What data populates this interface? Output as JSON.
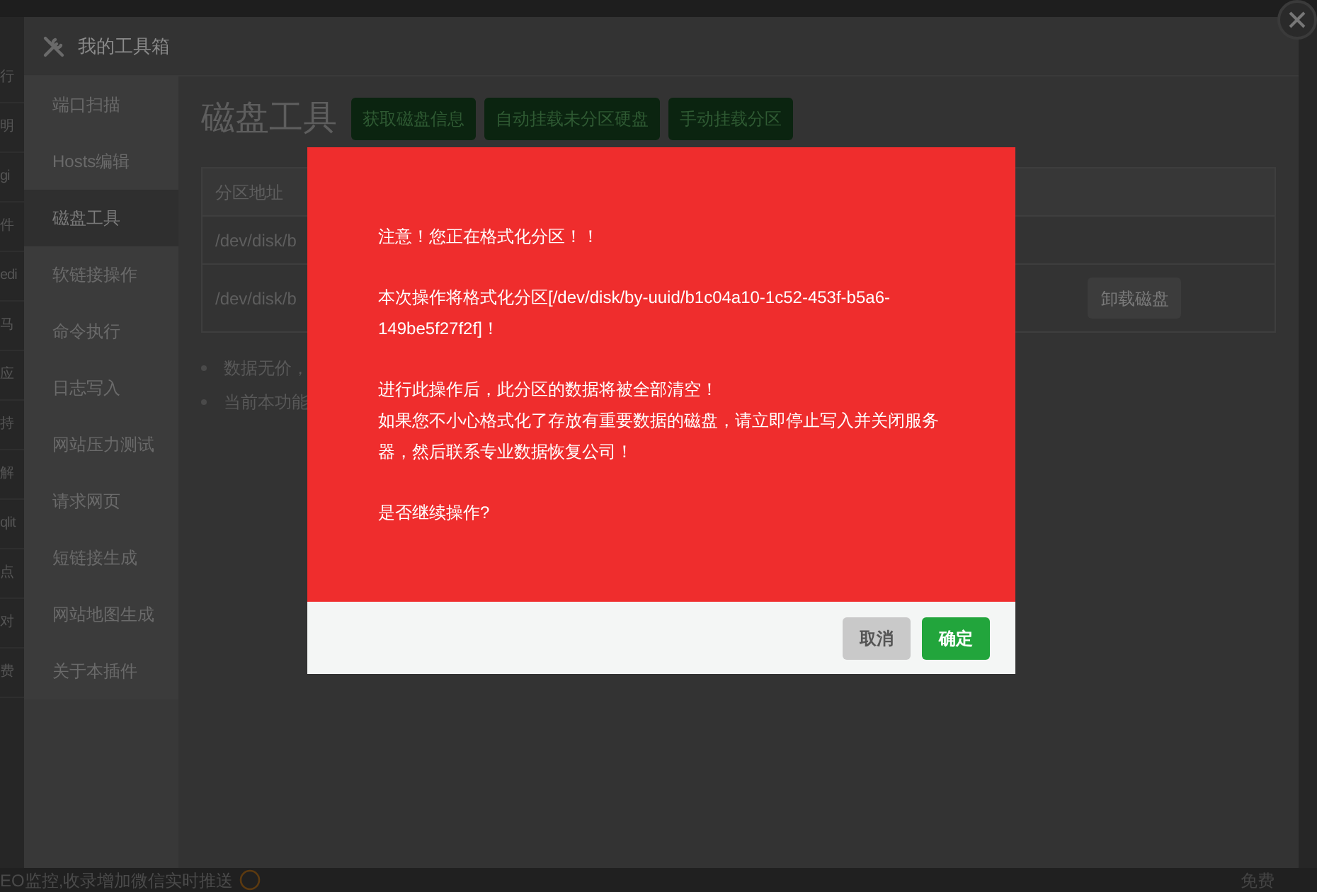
{
  "background_list": [
    "行",
    "明",
    "gi",
    "件",
    "edi",
    "马",
    "应",
    "持",
    "解",
    "qlit",
    "点",
    "对",
    "费"
  ],
  "toolbox": {
    "title": "我的工具箱",
    "sidebar": [
      {
        "label": "端口扫描",
        "selected": false
      },
      {
        "label": "Hosts编辑",
        "selected": false
      },
      {
        "label": "磁盘工具",
        "selected": true
      },
      {
        "label": "软链接操作",
        "selected": false
      },
      {
        "label": "命令执行",
        "selected": false
      },
      {
        "label": "日志写入",
        "selected": false
      },
      {
        "label": "网站压力测试",
        "selected": false
      },
      {
        "label": "请求网页",
        "selected": false
      },
      {
        "label": "短链接生成",
        "selected": false
      },
      {
        "label": "网站地图生成",
        "selected": false
      },
      {
        "label": "关于本插件",
        "selected": false
      }
    ],
    "heading": "磁盘工具",
    "buttons": [
      "获取磁盘信息",
      "自动挂载未分区硬盘",
      "手动挂载分区"
    ],
    "table": {
      "columns": [
        "分区地址"
      ],
      "rows": [
        {
          "column_1": "/dev/disk/b"
        },
        {
          "column_1": "/dev/disk/b",
          "action": "卸载磁盘"
        }
      ]
    },
    "notes": [
      "数据无价，",
      "当前本功能"
    ]
  },
  "dialog": {
    "paragraphs": [
      [
        "注意！您正在格式化分区！！"
      ],
      [
        "本次操作将格式化分区[/dev/disk/by-uuid/b1c04a10-1c52-453f-b5a6-149be5f27f2f]！"
      ],
      [
        "进行此操作后，此分区的数据将被全部清空！",
        "如果您不小心格式化了存放有重要数据的磁盘，请立即停止写入并关闭服务器，然后联系专业数据恢复公司！"
      ],
      [
        "是否继续操作?"
      ]
    ],
    "buttons": [
      {
        "label": "取消",
        "kind": "cancel"
      },
      {
        "label": "确定",
        "kind": "confirm"
      }
    ]
  },
  "footer": {
    "text": "EO监控,收录增加微信实时推送",
    "right": "免费"
  }
}
